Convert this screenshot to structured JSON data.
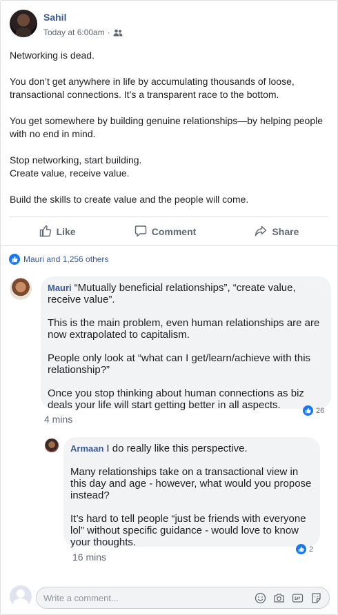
{
  "post": {
    "author": "Sahil",
    "timestamp": "Today at 6:00am",
    "privacy_icon": "friends-icon",
    "paragraphs": [
      "Networking is dead.",
      "You don’t get anywhere in life by accumulating thousands of loose, transactional connections. It’s a transparent race to the bottom.",
      "You get somewhere by building genuine relationships—by helping people with no end in mind.",
      "Stop networking, start building.\nCreate value, receive value.",
      "Build the skills to create value and the people will come."
    ]
  },
  "actions": {
    "like": "Like",
    "comment": "Comment",
    "share": "Share"
  },
  "reactions": {
    "summary": "Mauri and 1,256 others"
  },
  "comments": [
    {
      "name": "Mauri",
      "paragraphs": [
        "“Mutually beneficial relationships”, “create value, receive value”.",
        "This is the main problem, even human relationships are are now extrapolated to capitalism.",
        "People only look at “what can I get/learn/achieve with this relationship?”",
        "Once you stop thinking about human connections as biz deals your life will start getting better in all aspects."
      ],
      "time": "4 mins",
      "likes": "26"
    },
    {
      "name": "Armaan",
      "paragraphs": [
        "I do really like this perspective.",
        "Many relationships take on a transactional view in this day and age - however, what would you propose instead?",
        "It’s hard to tell people “just be friends with everyone lol” without specific guidance - would love to know your thoughts."
      ],
      "time": "16 mins",
      "likes": "2"
    }
  ],
  "composer": {
    "placeholder": "Write a comment..."
  },
  "colors": {
    "link": "#385898",
    "like_blue": "#1877f2",
    "muted": "#606770",
    "bubble": "#f2f3f5"
  }
}
